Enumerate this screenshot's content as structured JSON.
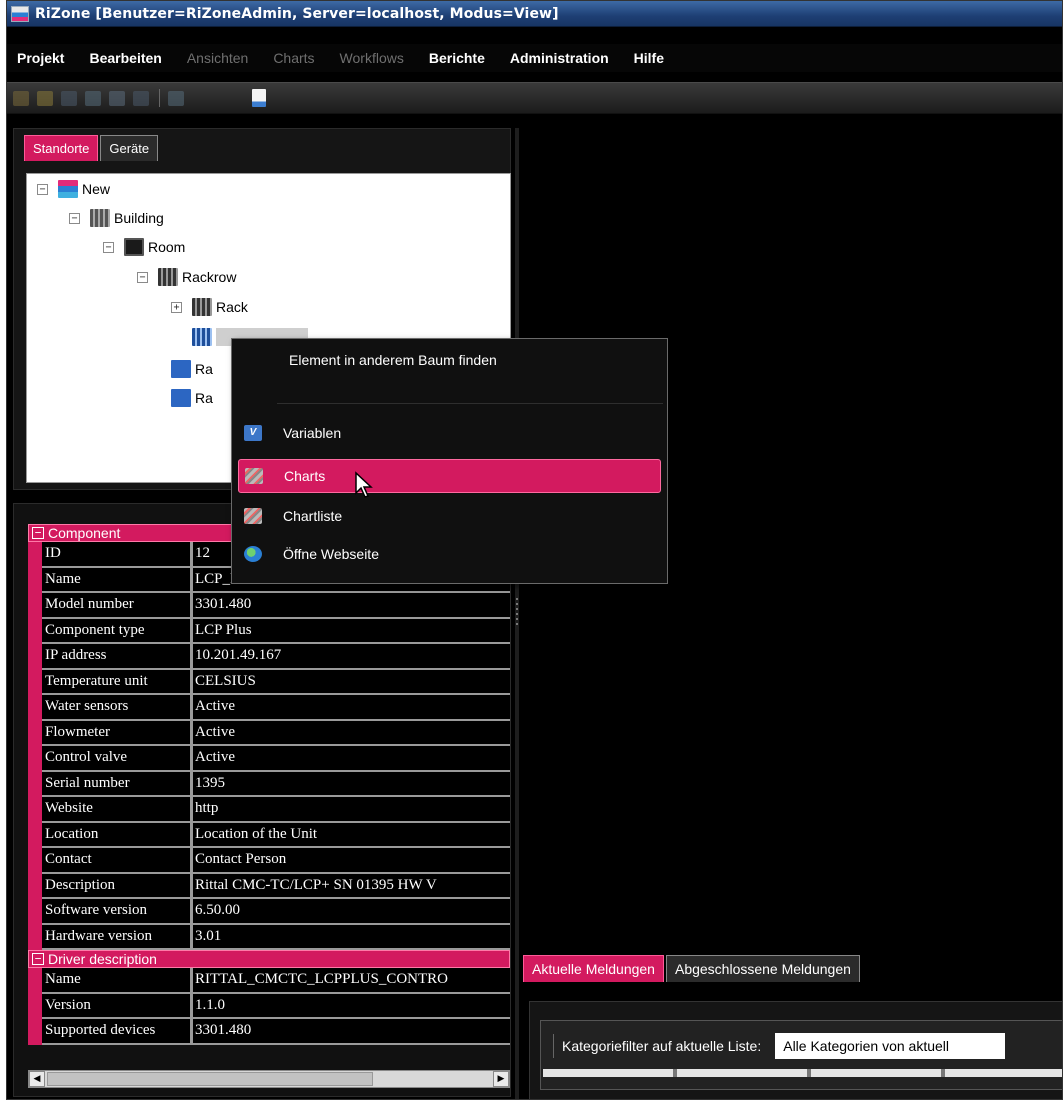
{
  "window": {
    "title": "RiZone [Benutzer=RiZoneAdmin, Server=localhost, Modus=View]"
  },
  "menu": [
    {
      "label": "Projekt",
      "enabled": true
    },
    {
      "label": "Bearbeiten",
      "enabled": true
    },
    {
      "label": "Ansichten",
      "enabled": false
    },
    {
      "label": "Charts",
      "enabled": false
    },
    {
      "label": "Workflows",
      "enabled": false
    },
    {
      "label": "Berichte",
      "enabled": true
    },
    {
      "label": "Administration",
      "enabled": true
    },
    {
      "label": "Hilfe",
      "enabled": true
    }
  ],
  "left_tabs": {
    "standorte": "Standorte",
    "geraete": "Geräte"
  },
  "tree": {
    "new": "New",
    "building": "Building",
    "room": "Room",
    "rackrow": "Rackrow",
    "rack": "Rack",
    "temp_item": "Ra",
    "water_item": "Ra"
  },
  "context_menu": {
    "find": "Element in anderem Baum finden",
    "variablen": "Variablen",
    "charts": "Charts",
    "chartliste": "Chartliste",
    "webseite": "Öffne Webseite"
  },
  "properties": {
    "component_header": "Component",
    "component": [
      {
        "key": "ID",
        "value": "12"
      },
      {
        "key": "Name",
        "value": "LCP_Plus"
      },
      {
        "key": "Model number",
        "value": "3301.480"
      },
      {
        "key": "Component type",
        "value": "LCP Plus"
      },
      {
        "key": "IP address",
        "value": "10.201.49.167"
      },
      {
        "key": "Temperature unit",
        "value": "CELSIUS"
      },
      {
        "key": "Water sensors",
        "value": "Active"
      },
      {
        "key": "Flowmeter",
        "value": "Active"
      },
      {
        "key": "Control valve",
        "value": "Active"
      },
      {
        "key": "Serial number",
        "value": "1395"
      },
      {
        "key": "Website",
        "value": "http"
      },
      {
        "key": "Location",
        "value": "Location of the Unit"
      },
      {
        "key": "Contact",
        "value": "Contact Person"
      },
      {
        "key": "Description",
        "value": "Rittal CMC-TC/LCP+ SN 01395 HW V"
      },
      {
        "key": "Software version",
        "value": "6.50.00"
      },
      {
        "key": "Hardware version",
        "value": "3.01"
      }
    ],
    "driver_header": "Driver description",
    "driver": [
      {
        "key": "Name",
        "value": "RITTAL_CMCTC_LCPPLUS_CONTRO"
      },
      {
        "key": "Version",
        "value": "1.1.0"
      },
      {
        "key": "Supported devices",
        "value": "3301.480"
      }
    ]
  },
  "messages": {
    "tab_current": "Aktuelle Meldungen",
    "tab_closed": "Abgeschlossene Meldungen",
    "filter_label": "Kategoriefilter auf aktuelle Liste:",
    "filter_value": "Alle Kategorien von aktuell"
  },
  "colors": {
    "accent": "#d31a5f",
    "title_bar": "#1e3f74",
    "background": "#000000"
  }
}
